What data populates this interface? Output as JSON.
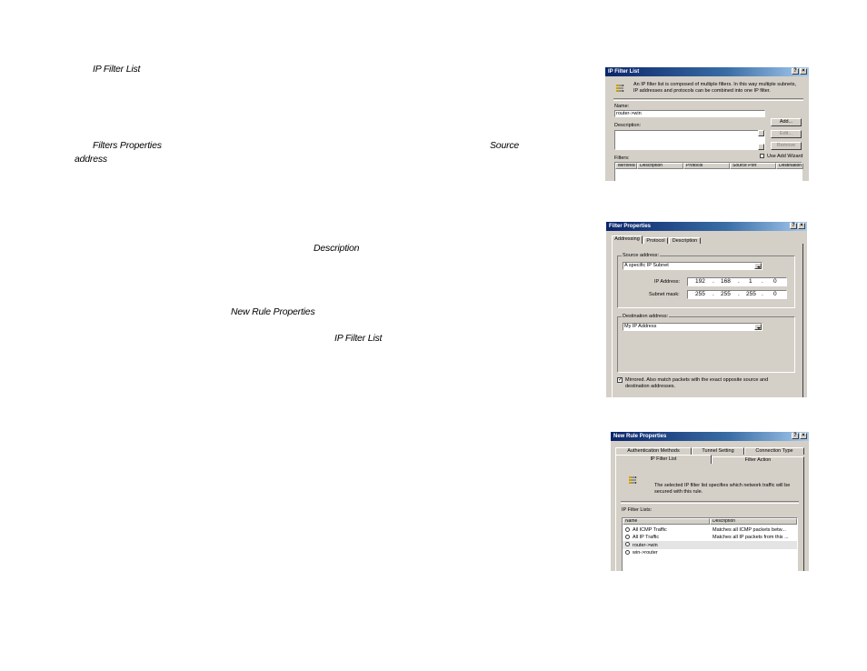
{
  "doc_labels": {
    "ip_filter_list_1": "IP Filter List",
    "filters_properties": "Filters Properties",
    "source": "Source",
    "address": "address",
    "description": "Description",
    "new_rule_properties": "New Rule Properties",
    "ip_filter_list_2": "IP Filter List"
  },
  "dlg1": {
    "title": "IP Filter List",
    "help_btn": "?",
    "close_btn": "×",
    "info": "An IP filter list is composed of multiple filters. In this way multiple subnets, IP addresses and protocols can be combined into one IP filter.",
    "name_label": "Name:",
    "name_value": "router->win",
    "desc_label": "Description:",
    "add_btn": "Add...",
    "edit_btn": "Edit...",
    "remove_btn": "Remove",
    "filters_label": "Filters:",
    "use_wizard": "Use Add Wizard",
    "columns": [
      "Mirrored",
      "Description",
      "Protocol",
      "Source Port",
      "Destination"
    ]
  },
  "dlg2": {
    "title": "Filter Properties",
    "help_btn": "?",
    "close_btn": "×",
    "tabs": [
      "Addressing",
      "Protocol",
      "Description"
    ],
    "source_group": "Source address:",
    "source_select": "A specific IP Subnet",
    "ip_label": "IP Address:",
    "ip_octets": [
      "192",
      "168",
      "1",
      "0"
    ],
    "mask_label": "Subnet mask:",
    "mask_octets": [
      "255",
      "255",
      "255",
      "0"
    ],
    "dest_group": "Destination address:",
    "dest_select": "My IP Address",
    "mirrored_text": "Mirrored. Also match packets with the exact opposite source and destination addresses."
  },
  "dlg3": {
    "title": "New Rule Properties",
    "help_btn": "?",
    "close_btn": "×",
    "tabs_row1": [
      "Authentication Methods",
      "Tunnel Setting",
      "Connection Type"
    ],
    "tabs_row2": [
      "IP Filter List",
      "Filter Action"
    ],
    "info": "The selected IP filter list specifies which network traffic will be secured with this rule.",
    "lists_label": "IP Filter Lists:",
    "columns": [
      "Name",
      "Description"
    ],
    "rows": [
      {
        "name": "All ICMP Traffic",
        "desc": "Matches all ICMP packets betw..."
      },
      {
        "name": "All IP Traffic",
        "desc": "Matches all IP packets from this ..."
      },
      {
        "name": "router->win",
        "desc": ""
      },
      {
        "name": "win->router",
        "desc": ""
      }
    ]
  }
}
